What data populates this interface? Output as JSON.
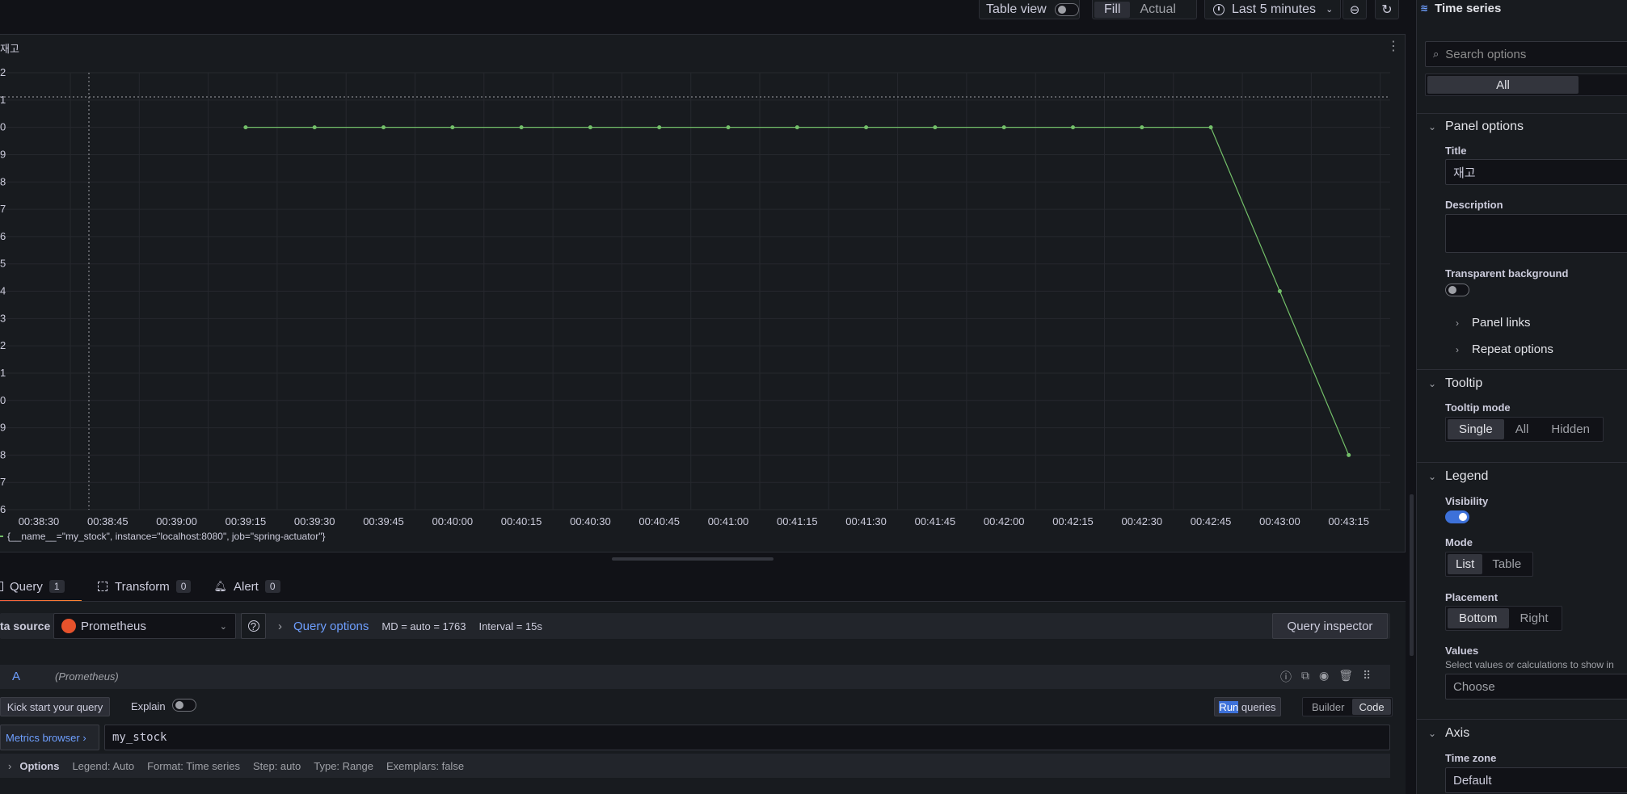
{
  "toolbar": {
    "table_view_label": "Table view",
    "fill_label": "Fill",
    "actual_label": "Actual",
    "time_range_label": "Last 5 minutes",
    "visualization_label": "Time series"
  },
  "panel": {
    "title": "재고",
    "legend_text": "{__name__=\"my_stock\", instance=\"localhost:8080\", job=\"spring-actuator\"}",
    "series_color": "#73bf69"
  },
  "chart_data": {
    "type": "line",
    "title": "재고",
    "x_ticks": [
      "00:38:30",
      "00:38:45",
      "00:39:00",
      "00:39:15",
      "00:39:30",
      "00:39:45",
      "00:40:00",
      "00:40:15",
      "00:40:30",
      "00:40:45",
      "00:41:00",
      "00:41:15",
      "00:41:30",
      "00:41:45",
      "00:42:00",
      "00:42:15",
      "00:42:30",
      "00:42:45",
      "00:43:00",
      "00:43:15"
    ],
    "y_ticks": [
      "2",
      "1",
      "0",
      "9",
      "8",
      "7",
      "6",
      "5",
      "4",
      "3",
      "2",
      "1",
      "0",
      "9",
      "8",
      "7",
      "6"
    ],
    "series": [
      {
        "x": [
          "00:39:15",
          "00:39:30",
          "00:39:45",
          "00:40:00",
          "00:40:15",
          "00:40:30",
          "00:40:45",
          "00:41:00",
          "00:41:15",
          "00:41:30",
          "00:41:45",
          "00:42:00",
          "00:42:15",
          "00:42:30",
          "00:42:45",
          "00:43:00",
          "00:43:15"
        ],
        "y": [
          20,
          20,
          20,
          20,
          20,
          20,
          20,
          20,
          20,
          20,
          20,
          20,
          20,
          20,
          20,
          14,
          8
        ]
      }
    ],
    "y_range": [
      6,
      22
    ],
    "grid": true,
    "legend_placement": "bottom"
  },
  "query_tabs": [
    {
      "label": "Query",
      "count": "1"
    },
    {
      "label": "Transform",
      "count": "0"
    },
    {
      "label": "Alert",
      "count": "0"
    }
  ],
  "query": {
    "datasource_label": "ta source",
    "datasource_value": "Prometheus",
    "query_options_label": "Query options",
    "md_info": "MD = auto = 1763",
    "interval_info": "Interval = 15s",
    "inspector_label": "Query inspector",
    "ref_id": "A",
    "ref_source": "(Prometheus)",
    "kick_start_label": "Kick start your query",
    "explain_label": "Explain",
    "run_label_highlight": "Run",
    "run_label_rest": " queries",
    "builder_label": "Builder",
    "code_label": "Code",
    "metrics_browser_label": "Metrics browser ›",
    "expression": "my_stock",
    "options_label": "Options",
    "legend_info": "Legend: Auto",
    "format_info": "Format: Time series",
    "step_info": "Step: auto",
    "type_info": "Type: Range",
    "exemplars_info": "Exemplars: false"
  },
  "sidebar": {
    "search_placeholder": "Search options",
    "all_label": "All",
    "panel_options_heading": "Panel options",
    "title_label": "Title",
    "title_value": "재고",
    "description_label": "Description",
    "transparent_label": "Transparent background",
    "panel_links_label": "Panel links",
    "repeat_options_label": "Repeat options",
    "tooltip_heading": "Tooltip",
    "tooltip_mode_label": "Tooltip mode",
    "tooltip_single": "Single",
    "tooltip_all": "All",
    "tooltip_hidden": "Hidden",
    "legend_heading": "Legend",
    "visibility_label": "Visibility",
    "mode_label": "Mode",
    "mode_list": "List",
    "mode_table": "Table",
    "placement_label": "Placement",
    "placement_bottom": "Bottom",
    "placement_right": "Right",
    "values_label": "Values",
    "values_hint": "Select values or calculations to show in",
    "values_placeholder": "Choose",
    "axis_heading": "Axis",
    "timezone_label": "Time zone",
    "timezone_value": "Default"
  }
}
